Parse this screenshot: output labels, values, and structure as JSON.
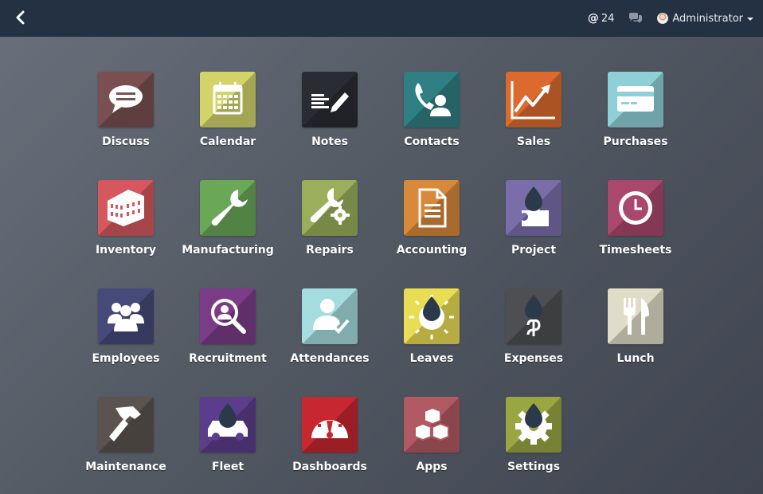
{
  "topbar": {
    "mentions_count": "24",
    "user_name": "Administrator"
  },
  "apps": [
    {
      "label": "Discuss",
      "color": "#7a4f52",
      "icon": "chat-bubble-icon"
    },
    {
      "label": "Calendar",
      "color": "#d2d46a",
      "icon": "calendar-icon"
    },
    {
      "label": "Notes",
      "color": "#2a2c33",
      "icon": "notes-pencil-icon"
    },
    {
      "label": "Contacts",
      "color": "#2f7f84",
      "icon": "phone-contact-icon"
    },
    {
      "label": "Sales",
      "color": "#dc6a2e",
      "icon": "sales-chart-icon"
    },
    {
      "label": "Purchases",
      "color": "#8fd0d8",
      "icon": "credit-card-icon"
    },
    {
      "label": "Inventory",
      "color": "#d4585e",
      "icon": "warehouse-icon"
    },
    {
      "label": "Manufacturing",
      "color": "#6aa857",
      "icon": "wrench-icon"
    },
    {
      "label": "Repairs",
      "color": "#9aae5b",
      "icon": "wrench-gear-icon"
    },
    {
      "label": "Accounting",
      "color": "#d8893a",
      "icon": "document-icon"
    },
    {
      "label": "Project",
      "color": "#7a6eaa",
      "icon": "puzzle-drop-icon"
    },
    {
      "label": "Timesheets",
      "color": "#a9486c",
      "icon": "clock-icon"
    },
    {
      "label": "Employees",
      "color": "#454a79",
      "icon": "team-icon"
    },
    {
      "label": "Recruitment",
      "color": "#7a3c86",
      "icon": "magnifier-person-icon"
    },
    {
      "label": "Attendances",
      "color": "#a5dcdf",
      "icon": "person-check-icon"
    },
    {
      "label": "Leaves",
      "color": "#e9dd54",
      "icon": "sun-drop-icon"
    },
    {
      "label": "Expenses",
      "color": "#4d4f52",
      "icon": "money-drop-icon"
    },
    {
      "label": "Lunch",
      "color": "#e1dcc8",
      "icon": "fork-knife-icon"
    },
    {
      "label": "Maintenance",
      "color": "#5b5350",
      "icon": "hammer-icon"
    },
    {
      "label": "Fleet",
      "color": "#5c3d8c",
      "icon": "car-drop-icon"
    },
    {
      "label": "Dashboards",
      "color": "#c7272f",
      "icon": "gauge-icon"
    },
    {
      "label": "Apps",
      "color": "#b25a63",
      "icon": "cubes-icon"
    },
    {
      "label": "Settings",
      "color": "#9aa642",
      "icon": "gear-drop-icon"
    }
  ]
}
